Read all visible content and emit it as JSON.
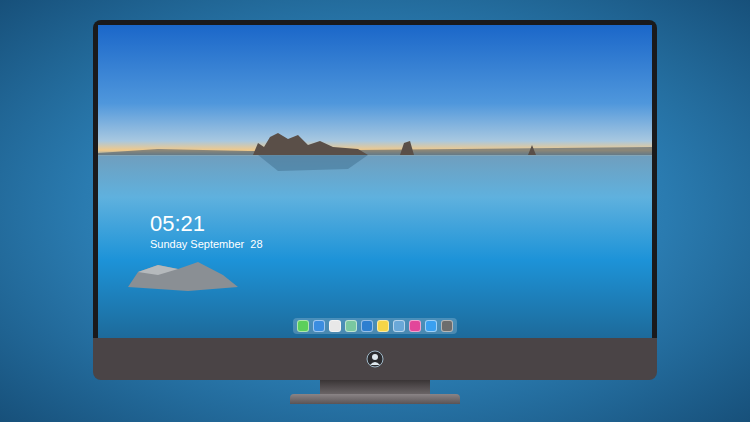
{
  "lock_screen": {
    "time": "05:21",
    "date": "Sunday September  28"
  },
  "dock": [
    {
      "color": "#5ccf5c"
    },
    {
      "color": "#3b8de0"
    },
    {
      "color": "#e8e8e8"
    },
    {
      "color": "#7ac8a0"
    },
    {
      "color": "#2d7fd0"
    },
    {
      "color": "#f5d547"
    },
    {
      "color": "#6aa8d8"
    },
    {
      "color": "#e2469a"
    },
    {
      "color": "#3aa0f0"
    },
    {
      "color": "#6d6d6d"
    }
  ]
}
